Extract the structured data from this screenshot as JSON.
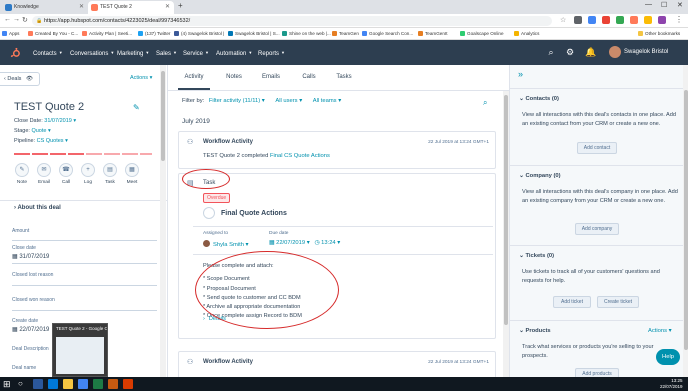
{
  "browser": {
    "tabs": [
      {
        "label": "Knowledge",
        "active": false
      },
      {
        "label": "TEST Quote 2",
        "active": true
      }
    ],
    "new_tab": "+",
    "url": "https://app.hubspot.com/contacts/4223025/deal/997346532/",
    "bookmarks": [
      "Apps",
      "Created By You - C...",
      "Activity Plan | Seeti...",
      "(137) Twitter",
      "(4) Swagelok Bristol |",
      "Swagelok Bristol | S...",
      "Shine on the web |...",
      "TeamGen",
      "Google Search Con...",
      "TeamGenIt",
      "Goalscape Online",
      "Analytics"
    ],
    "other_bookmarks": "Other bookmarks"
  },
  "nav": {
    "items": [
      "Contacts",
      "Conversations",
      "Marketing",
      "Sales",
      "Service",
      "Automation",
      "Reports"
    ],
    "user": "Swagelok Bristol"
  },
  "left": {
    "back": "Deals",
    "actions": "Actions",
    "title": "TEST Quote 2",
    "close_date_label": "Close Date:",
    "close_date": "31/07/2019",
    "stage_label": "Stage:",
    "stage": "Quote",
    "pipeline_label": "Pipeline:",
    "pipeline": "CS Quotes",
    "action_buttons": [
      "Note",
      "Email",
      "Call",
      "Log",
      "Task",
      "Meet"
    ],
    "about": "About this deal",
    "fields": {
      "amount": "Amount",
      "close_date": "Close date",
      "close_date_val": "31/07/2019",
      "closed_lost": "Closed lost reason",
      "closed_won": "Closed won reason",
      "create_date": "Create date",
      "create_date_val": "22/07/2019",
      "deal_desc": "Deal Description",
      "deal_name": "Deal name"
    },
    "preview_title": "TEST Quote 2 - Google Chrome"
  },
  "middle": {
    "tabs": [
      "Activity",
      "Notes",
      "Emails",
      "Calls",
      "Tasks"
    ],
    "filter_by": "Filter by:",
    "filter_activity": "Filter activity (11/11)",
    "all_users": "All users",
    "all_teams": "All teams",
    "month": "July 2019",
    "workflow1": {
      "title": "Workflow Activity",
      "date": "22 Jul 2019 at 13:24 GMT+1",
      "body_prefix": "TEST Quote 2 completed",
      "body_link": "Final CS Quote Actions"
    },
    "task": {
      "label": "Task",
      "overdue": "Overdue",
      "name": "Final Quote Actions",
      "assigned_label": "Assigned to",
      "due_label": "Due date",
      "assignee": "Shyla Smith",
      "due_date": "22/07/2019",
      "due_time": "13:24",
      "desc": [
        "Please complete and attach:",
        "",
        "* Scope Document",
        "* Proposal Document",
        "* Send quote to customer and CC BDM",
        "* Archive all appropriate documentation",
        "* Once complete assign Record to BDM"
      ],
      "details": "Details"
    },
    "workflow2": {
      "title": "Workflow Activity",
      "date": "22 Jul 2019 at 13:24 GMT+1"
    }
  },
  "right": {
    "contacts": {
      "header": "Contacts (0)",
      "text": "View all interactions with this deal's contacts in one place. Add an existing contact from your CRM or create a new one.",
      "button": "Add contact"
    },
    "company": {
      "header": "Company (0)",
      "text": "View all interactions with this deal's company in one place. Add an existing company from your CRM or create a new one.",
      "button": "Add company"
    },
    "tickets": {
      "header": "Tickets (0)",
      "text": "Use tickets to track all of your customers' questions and requests for help.",
      "button1": "Add ticket",
      "button2": "Create ticket"
    },
    "products": {
      "header": "Products",
      "actions": "Actions",
      "text": "Track what services or products you're selling to your prospects.",
      "button": "Add products"
    },
    "help": "Help"
  },
  "taskbar": {
    "time": "13:25",
    "date": "22/07/2019"
  }
}
